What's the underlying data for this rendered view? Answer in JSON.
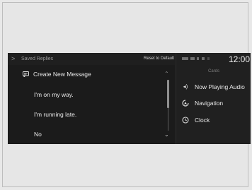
{
  "left_panel": {
    "back_glyph": ">",
    "title": "Saved Replies",
    "reset_label": "Reset to Default",
    "items": [
      {
        "label": "Create New Message",
        "icon": "message-icon"
      },
      {
        "label": "I'm on my way."
      },
      {
        "label": "I'm running late."
      },
      {
        "label": "No"
      }
    ],
    "scroll_up_glyph": "⌃",
    "scroll_down_glyph": "⌄"
  },
  "right_panel": {
    "clock": "12:00",
    "section_title": "Cards",
    "cards": [
      {
        "label": "Now Playing Audio",
        "icon": "audio-icon",
        "glyph": "◂)"
      },
      {
        "label": "Navigation",
        "icon": "navigation-icon",
        "glyph": "⬚"
      },
      {
        "label": "Clock",
        "icon": "clock-icon",
        "glyph": "◷"
      }
    ]
  },
  "colors": {
    "screen_bg": "#1b1b1b",
    "text": "#e9e9e9",
    "muted": "#9a9a9a"
  }
}
